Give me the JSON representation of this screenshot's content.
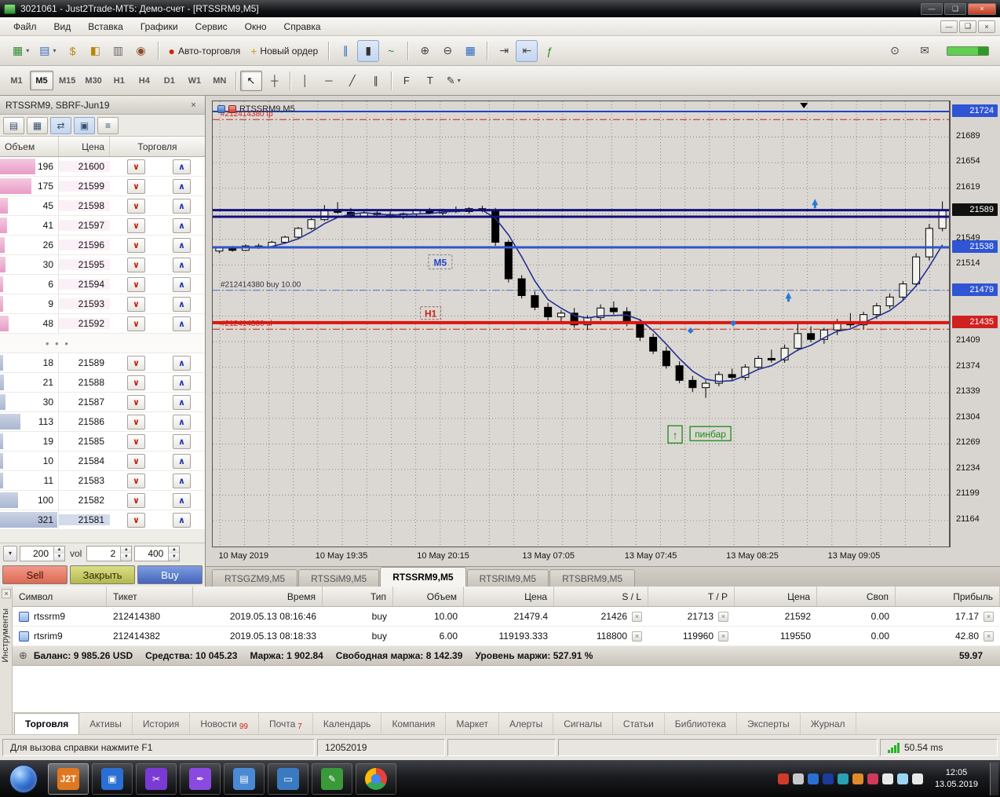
{
  "window": {
    "title": "3021061 - Just2Trade-MT5: Демо-счет - [RTSSRM9,M5]",
    "controls": {
      "minimize": "—",
      "restore": "❑",
      "close": "×"
    }
  },
  "menu": {
    "items": [
      {
        "label": "Файл",
        "name": "menu-file"
      },
      {
        "label": "Вид",
        "name": "menu-view"
      },
      {
        "label": "Вставка",
        "name": "menu-insert"
      },
      {
        "label": "Графики",
        "name": "menu-charts"
      },
      {
        "label": "Сервис",
        "name": "menu-tools"
      },
      {
        "label": "Окно",
        "name": "menu-window"
      },
      {
        "label": "Справка",
        "name": "menu-help"
      }
    ],
    "child_controls": [
      {
        "name": "child-minimize-button",
        "glyph": "—"
      },
      {
        "name": "child-restore-button",
        "glyph": "❑"
      },
      {
        "name": "child-close-button",
        "glyph": "×"
      }
    ]
  },
  "toolbar": {
    "groups": [
      [
        {
          "name": "new-chart-button",
          "glyph": "▦",
          "color": "#2e8a2e",
          "dropdown": true
        },
        {
          "name": "profiles-button",
          "glyph": "▤",
          "color": "#3a6ac0",
          "dropdown": true
        },
        {
          "name": "market-watch-button",
          "glyph": "$",
          "color": "#b8860b"
        },
        {
          "name": "history-center-button",
          "glyph": "◧",
          "color": "#b8860b"
        },
        {
          "name": "print-button",
          "glyph": "▥",
          "color": "#666666"
        },
        {
          "name": "connection-button",
          "glyph": "◉",
          "color": "#8a4a2a"
        }
      ],
      [
        {
          "name": "autotrade-button",
          "glyph": "●",
          "color": "#cc2214",
          "label": "Авто-торговля"
        },
        {
          "name": "new-order-button",
          "glyph": "+",
          "color": "#d4a017",
          "label": "Новый ордер"
        }
      ],
      [
        {
          "name": "bar-chart-button",
          "glyph": "∥",
          "color": "#2a6ac0"
        },
        {
          "name": "candlestick-chart-button",
          "glyph": "▮",
          "color": "#333333",
          "pressed": true
        },
        {
          "name": "line-chart-button",
          "glyph": "~",
          "color": "#2a8a2a"
        }
      ],
      [
        {
          "name": "zoom-in-button",
          "glyph": "⊕",
          "color": "#444444"
        },
        {
          "name": "zoom-out-button",
          "glyph": "⊖",
          "color": "#444444"
        },
        {
          "name": "tile-windows-button",
          "glyph": "▦",
          "color": "#2a6ac0"
        }
      ],
      [
        {
          "name": "auto-scroll-button",
          "glyph": "⇥",
          "color": "#444444"
        },
        {
          "name": "chart-shift-button",
          "glyph": "⇤",
          "color": "#444444",
          "pressed": true
        },
        {
          "name": "indicators-button",
          "glyph": "ƒ",
          "color": "#2a8a2a"
        }
      ]
    ],
    "right": [
      {
        "name": "search-button",
        "glyph": "⊙"
      },
      {
        "name": "feedback-button",
        "glyph": "✉"
      }
    ]
  },
  "timeframe_bar": {
    "timeframes": [
      "M1",
      "M5",
      "M15",
      "M30",
      "H1",
      "H4",
      "D1",
      "W1",
      "MN"
    ],
    "active": "M5",
    "tools": [
      {
        "name": "cursor-tool",
        "glyph": "↖",
        "pressed": true
      },
      {
        "name": "crosshair-tool",
        "glyph": "┼"
      },
      {
        "name": "vertical-line-tool",
        "glyph": "│",
        "sep_before": true
      },
      {
        "name": "horizontal-line-tool",
        "glyph": "─"
      },
      {
        "name": "trendline-tool",
        "glyph": "╱"
      },
      {
        "name": "equidistant-channel-tool",
        "glyph": "∥"
      },
      {
        "name": "fibonacci-tool",
        "glyph": "F",
        "sep_before": true
      },
      {
        "name": "text-tool",
        "glyph": "T"
      },
      {
        "name": "objects-tool",
        "glyph": "✎",
        "dropdown": true
      }
    ]
  },
  "dom": {
    "title": "RTSSRM9, SBRF-Jun19",
    "close_glyph": "×",
    "toolbar": [
      {
        "name": "dom-chart-button",
        "glyph": "▤"
      },
      {
        "name": "dom-grid-button",
        "glyph": "▦"
      },
      {
        "name": "dom-orders-button",
        "glyph": "⇄",
        "pressed": true
      },
      {
        "name": "dom-oneclick-button",
        "glyph": "▣",
        "pressed": true
      },
      {
        "name": "dom-filter-button",
        "glyph": "≡"
      }
    ],
    "columns": [
      "Объем",
      "Цена",
      "Торговля"
    ],
    "sell_arrow": "∨",
    "buy_arrow": "∧",
    "asks": [
      [
        "196",
        "21600"
      ],
      [
        "175",
        "21599"
      ],
      [
        "45",
        "21598"
      ],
      [
        "41",
        "21597"
      ],
      [
        "26",
        "21596"
      ],
      [
        "30",
        "21595"
      ],
      [
        "6",
        "21594"
      ],
      [
        "9",
        "21593"
      ],
      [
        "48",
        "21592"
      ]
    ],
    "separator": "• • •",
    "bids": [
      [
        "18",
        "21589"
      ],
      [
        "21",
        "21588"
      ],
      [
        "30",
        "21587"
      ],
      [
        "113",
        "21586"
      ],
      [
        "19",
        "21585"
      ],
      [
        "10",
        "21584"
      ],
      [
        "11",
        "21583"
      ],
      [
        "100",
        "21582"
      ],
      [
        "321",
        "21581"
      ]
    ],
    "controls": {
      "dropdown_glyph": "▾",
      "lot": "200",
      "vol_label": "vol",
      "vol": "2",
      "slippage": "400"
    },
    "buttons": {
      "sell": "Sell",
      "close": "Закрыть",
      "buy": "Buy"
    }
  },
  "chart": {
    "symbol_overlay": "RTSSRM9,M5",
    "tabs": [
      "RTSGZM9,M5",
      "RTSSiM9,M5",
      "RTSSRM9,M5",
      "RTSRIM9,M5",
      "RTSBRM9,M5"
    ],
    "active_tab": "RTSSRM9,M5"
  },
  "chart_data": {
    "type": "candlestick",
    "title": "RTSSRM9,M5",
    "ylim": [
      21164,
      21724
    ],
    "y_ticks": [
      21724,
      21689,
      21654,
      21619,
      21584,
      21549,
      21514,
      21479,
      21444,
      21409,
      21374,
      21339,
      21304,
      21269,
      21234,
      21199,
      21164
    ],
    "x_labels": [
      {
        "text": "10 May 2019",
        "pos": 0.043
      },
      {
        "text": "10 May 19:35",
        "pos": 0.176
      },
      {
        "text": "10 May 20:15",
        "pos": 0.314
      },
      {
        "text": "13 May 07:05",
        "pos": 0.457
      },
      {
        "text": "13 May 07:45",
        "pos": 0.596
      },
      {
        "text": "13 May 08:25",
        "pos": 0.734
      },
      {
        "text": "13 May 09:05",
        "pos": 0.872
      }
    ],
    "ma_period": 4,
    "candles": [
      [
        21533,
        21539,
        21530,
        21537
      ],
      [
        21537,
        21540,
        21532,
        21534
      ],
      [
        21534,
        21542,
        21533,
        21540
      ],
      [
        21540,
        21543,
        21536,
        21538
      ],
      [
        21538,
        21547,
        21537,
        21545
      ],
      [
        21545,
        21554,
        21543,
        21552
      ],
      [
        21552,
        21566,
        21550,
        21564
      ],
      [
        21564,
        21578,
        21562,
        21576
      ],
      [
        21576,
        21596,
        21574,
        21590
      ],
      [
        21590,
        21600,
        21584,
        21586
      ],
      [
        21586,
        21592,
        21578,
        21581
      ],
      [
        21581,
        21588,
        21579,
        21585
      ],
      [
        21585,
        21590,
        21580,
        21583
      ],
      [
        21583,
        21587,
        21578,
        21580
      ],
      [
        21580,
        21586,
        21577,
        21584
      ],
      [
        21584,
        21590,
        21581,
        21588
      ],
      [
        21588,
        21592,
        21583,
        21585
      ],
      [
        21585,
        21591,
        21582,
        21589
      ],
      [
        21589,
        21594,
        21585,
        21587
      ],
      [
        21587,
        21593,
        21584,
        21591
      ],
      [
        21591,
        21595,
        21586,
        21589
      ],
      [
        21589,
        21592,
        21540,
        21545
      ],
      [
        21545,
        21548,
        21490,
        21495
      ],
      [
        21495,
        21500,
        21468,
        21472
      ],
      [
        21472,
        21478,
        21452,
        21456
      ],
      [
        21456,
        21462,
        21438,
        21443
      ],
      [
        21443,
        21452,
        21436,
        21448
      ],
      [
        21448,
        21455,
        21428,
        21432
      ],
      [
        21432,
        21445,
        21425,
        21442
      ],
      [
        21442,
        21460,
        21438,
        21455
      ],
      [
        21455,
        21464,
        21446,
        21450
      ],
      [
        21450,
        21456,
        21430,
        21435
      ],
      [
        21435,
        21440,
        21410,
        21415
      ],
      [
        21415,
        21420,
        21392,
        21396
      ],
      [
        21396,
        21402,
        21372,
        21376
      ],
      [
        21376,
        21382,
        21352,
        21356
      ],
      [
        21356,
        21362,
        21340,
        21346
      ],
      [
        21346,
        21356,
        21332,
        21352
      ],
      [
        21352,
        21368,
        21348,
        21364
      ],
      [
        21364,
        21372,
        21355,
        21360
      ],
      [
        21360,
        21378,
        21356,
        21374
      ],
      [
        21374,
        21390,
        21370,
        21386
      ],
      [
        21386,
        21398,
        21380,
        21384
      ],
      [
        21384,
        21405,
        21380,
        21400
      ],
      [
        21400,
        21437,
        21396,
        21420
      ],
      [
        21420,
        21430,
        21408,
        21412
      ],
      [
        21412,
        21428,
        21406,
        21425
      ],
      [
        21425,
        21440,
        21418,
        21436
      ],
      [
        21436,
        21448,
        21428,
        21432
      ],
      [
        21432,
        21450,
        21426,
        21446
      ],
      [
        21446,
        21462,
        21440,
        21458
      ],
      [
        21458,
        21475,
        21454,
        21470
      ],
      [
        21470,
        21492,
        21466,
        21488
      ],
      [
        21488,
        21530,
        21484,
        21525
      ],
      [
        21525,
        21570,
        21520,
        21564
      ],
      [
        21564,
        21601,
        21560,
        21589
      ]
    ],
    "levels": [
      {
        "price": 21724,
        "style": "solid",
        "color": "#2244bb",
        "width": 2,
        "name": "resistance-line-top"
      },
      {
        "price": 21713,
        "style": "dashdot",
        "color": "#cc2214",
        "width": 1,
        "label": "#212414380 tp",
        "label_color": "#cc2214",
        "name": "take-profit-line"
      },
      {
        "price": 21589,
        "style": "solid",
        "color": "#10107a",
        "width": 3,
        "name": "resistance-line-1"
      },
      {
        "price": 21580,
        "style": "solid",
        "color": "#10107a",
        "width": 3,
        "name": "resistance-line-2"
      },
      {
        "price": 21538,
        "style": "solid",
        "color": "#2f55cc",
        "width": 3,
        "name": "support-line-blue"
      },
      {
        "price": 21479.4,
        "style": "dashdot",
        "color": "#4a78d4",
        "width": 1,
        "label": "#212414380 buy 10.00",
        "label_color": "#333344",
        "name": "position-open-line"
      },
      {
        "price": 21435,
        "style": "solid",
        "color": "#dd1510",
        "width": 4,
        "name": "stop-level-line"
      },
      {
        "price": 21426,
        "style": "dashdot",
        "color": "#cc2214",
        "width": 1,
        "label": "#212414380 sl",
        "label_color": "#cc2214",
        "name": "stop-loss-line"
      }
    ],
    "badges": [
      {
        "text": "21724",
        "price": 21724,
        "color": "#2f55d4",
        "name": "level-badge-21724"
      },
      {
        "text": "21589",
        "price": 21589,
        "color": "#111111",
        "name": "bid-price-badge"
      },
      {
        "text": "21538",
        "price": 21538,
        "color": "#2f55d4",
        "name": "level-badge-21538"
      },
      {
        "text": "21479",
        "price": 21479.4,
        "color": "#2f55d4",
        "name": "open-price-badge"
      },
      {
        "text": "21435",
        "price": 21435,
        "color": "#d02020",
        "name": "stop-level-badge"
      }
    ],
    "objects": {
      "m5": {
        "text": "M5",
        "x": 0.309,
        "price": 21516
      },
      "h1": {
        "text": "H1",
        "x": 0.296,
        "price": 21446
      },
      "pinbar": {
        "text": "пинбар",
        "x": 0.676,
        "price": 21282
      },
      "arrow_box": {
        "glyph": "↑",
        "x": 0.628,
        "price": 21282
      },
      "top_triangle_x": 0.803
    },
    "markers": {
      "diamonds": [
        {
          "x": 0.649,
          "price": 21424
        },
        {
          "x": 0.707,
          "price": 21434
        }
      ],
      "arrows": [
        {
          "x": 0.782,
          "price": 21470
        },
        {
          "x": 0.818,
          "price": 21598
        }
      ]
    }
  },
  "trade_panel": {
    "columns": [
      "Символ",
      "Тикет",
      "Время",
      "Тип",
      "Объем",
      "Цена",
      "S / L",
      "T / P",
      "Цена",
      "Своп",
      "Прибыль"
    ],
    "rows": [
      {
        "symbol": "rtssrm9",
        "ticket": "212414380",
        "time": "2019.05.13 08:16:46",
        "type": "buy",
        "volume": "10.00",
        "price": "21479.4",
        "sl": "21426",
        "tp": "21713",
        "price_current": "21592",
        "swap": "0.00",
        "profit": "17.17"
      },
      {
        "symbol": "rtsrim9",
        "ticket": "212414382",
        "time": "2019.05.13 08:18:33",
        "type": "buy",
        "volume": "6.00",
        "price": "119193.333",
        "sl": "118800",
        "tp": "119960",
        "price_current": "119550",
        "swap": "0.00",
        "profit": "42.80"
      }
    ],
    "remove_glyph": "×",
    "balance": {
      "icon": "⊕",
      "segments": [
        "Баланс: 9 985.26 USD",
        "Средства: 10 045.23",
        "Маржа: 1 902.84",
        "Свободная маржа: 8 142.39",
        "Уровень маржи: 527.91 %"
      ],
      "right": "59.97"
    },
    "active_tab": "Торговля",
    "tabs": [
      {
        "label": "Торговля",
        "name": "trade"
      },
      {
        "label": "Активы",
        "name": "assets"
      },
      {
        "label": "История",
        "name": "history"
      },
      {
        "label": "Новости",
        "name": "news",
        "badge": "99"
      },
      {
        "label": "Почта",
        "name": "mail",
        "badge": "7"
      },
      {
        "label": "Календарь",
        "name": "calendar"
      },
      {
        "label": "Компания",
        "name": "company"
      },
      {
        "label": "Маркет",
        "name": "market"
      },
      {
        "label": "Алерты",
        "name": "alerts"
      },
      {
        "label": "Сигналы",
        "name": "signals"
      },
      {
        "label": "Статьи",
        "name": "articles"
      },
      {
        "label": "Библиотека",
        "name": "library"
      },
      {
        "label": "Эксперты",
        "name": "experts"
      },
      {
        "label": "Журнал",
        "name": "journal"
      }
    ],
    "side_label": "Инструменты",
    "close_glyph": "×"
  },
  "status_bar": {
    "help": "Для вызова справки нажмите F1",
    "date_field": "12052019",
    "latency": "50.54 ms"
  },
  "taskbar": {
    "apps": [
      {
        "name": "taskbar-app-j2t",
        "label": "J2T",
        "color": "#e07820",
        "active": true
      },
      {
        "name": "taskbar-app-remote-desktop",
        "glyph": "▣",
        "color": "#2a6fd4"
      },
      {
        "name": "taskbar-app-snipping-tool",
        "glyph": "✂",
        "color": "#7a3ad4"
      },
      {
        "name": "taskbar-app-feather",
        "glyph": "✒",
        "color": "#8a4ae0"
      },
      {
        "name": "taskbar-app-notepad",
        "glyph": "▤",
        "color": "#4a8ad4"
      },
      {
        "name": "taskbar-app-computer",
        "glyph": "▭",
        "color": "#3a7ac0"
      },
      {
        "name": "taskbar-app-editor",
        "glyph": "✎",
        "color": "#3a9a3a"
      },
      {
        "name": "taskbar-app-chrome",
        "chrome": true
      }
    ],
    "tray": [
      {
        "name": "tray-icon-red",
        "color": "#d03a2a"
      },
      {
        "name": "tray-icon-gray",
        "color": "#c8c8c8"
      },
      {
        "name": "tray-icon-blue",
        "color": "#2a6fd4"
      },
      {
        "name": "tray-icon-navy",
        "color": "#1a3a9c"
      },
      {
        "name": "tray-icon-teal",
        "color": "#2aa0b4"
      },
      {
        "name": "tray-icon-orange",
        "color": "#e08a2a"
      },
      {
        "name": "tray-icon-kaspersky",
        "color": "#d03a5a"
      },
      {
        "name": "tray-flag-icon",
        "color": "#e8e8e8"
      },
      {
        "name": "tray-display-icon",
        "color": "#9ad4f0"
      },
      {
        "name": "tray-volume-icon",
        "color": "#e8e8e8"
      }
    ],
    "clock": {
      "time": "12:05",
      "date": "13.05.2019"
    }
  }
}
